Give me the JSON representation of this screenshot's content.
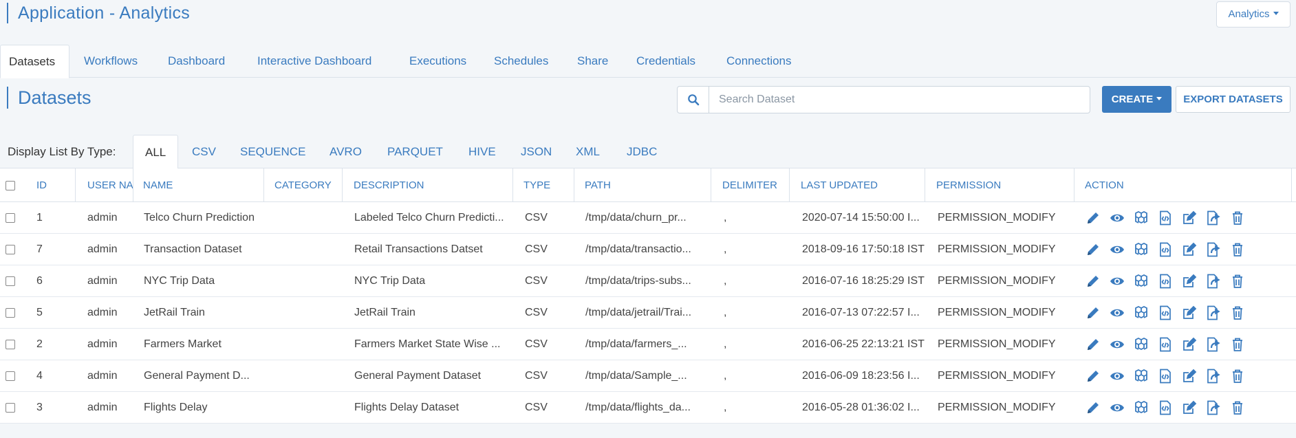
{
  "app": {
    "title": "Application - Analytics",
    "dropdown_label": "Analytics"
  },
  "main_tabs": [
    "Datasets",
    "Workflows",
    "Dashboard",
    "Interactive Dashboard",
    "Executions",
    "Schedules",
    "Share",
    "Credentials",
    "Connections"
  ],
  "section": {
    "title": "Datasets",
    "search_placeholder": "Search Dataset",
    "create_label": "CREATE",
    "export_label": "EXPORT DATASETS"
  },
  "type_filter": {
    "label": "Display List By Type:",
    "types": [
      "ALL",
      "CSV",
      "SEQUENCE",
      "AVRO",
      "PARQUET",
      "HIVE",
      "JSON",
      "XML",
      "JDBC"
    ],
    "selected": "ALL"
  },
  "table": {
    "columns": [
      "ID",
      "USER NA...",
      "NAME",
      "CATEGORY",
      "DESCRIPTION",
      "TYPE",
      "PATH",
      "DELIMITER",
      "LAST UPDATED",
      "PERMISSION",
      "ACTION"
    ],
    "rows": [
      [
        "1",
        "admin",
        "Telco Churn Prediction",
        "",
        "Labeled Telco Churn Predicti...",
        "CSV",
        "/tmp/data/churn_pr...",
        ",",
        "2020-07-14 15:50:00 I...",
        "PERMISSION_MODIFY"
      ],
      [
        "7",
        "admin",
        "Transaction Dataset",
        "",
        "Retail Transactions Datset",
        "CSV",
        "/tmp/data/transactio...",
        ",",
        "2018-09-16 17:50:18 IST",
        "PERMISSION_MODIFY"
      ],
      [
        "6",
        "admin",
        "NYC Trip Data",
        "",
        "NYC Trip Data",
        "CSV",
        "/tmp/data/trips-subs...",
        ",",
        "2016-07-16 18:25:29 IST",
        "PERMISSION_MODIFY"
      ],
      [
        "5",
        "admin",
        "JetRail Train",
        "",
        "JetRail Train",
        "CSV",
        "/tmp/data/jetrail/Trai...",
        ",",
        "2016-07-13 07:22:57 I...",
        "PERMISSION_MODIFY"
      ],
      [
        "2",
        "admin",
        "Farmers Market",
        "",
        "Farmers Market State Wise ...",
        "CSV",
        "/tmp/data/farmers_...",
        ",",
        "2016-06-25 22:13:21 IST",
        "PERMISSION_MODIFY"
      ],
      [
        "4",
        "admin",
        "General Payment D...",
        "",
        "General Payment Dataset",
        "CSV",
        "/tmp/data/Sample_...",
        ",",
        "2016-06-09 18:23:56 I...",
        "PERMISSION_MODIFY"
      ],
      [
        "3",
        "admin",
        "Flights Delay",
        "",
        "Flights Delay Dataset",
        "CSV",
        "/tmp/data/flights_da...",
        ",",
        "2016-05-28 01:36:02 I...",
        "PERMISSION_MODIFY"
      ]
    ],
    "row_actions": [
      "pencil-icon",
      "eye-icon",
      "cubes-icon",
      "code-file-icon",
      "edit-square-icon",
      "share-file-icon",
      "trash-icon"
    ]
  },
  "colors": {
    "accent": "#3a7bbf",
    "background": "#f3f6f9",
    "border": "#dbe2ea"
  }
}
